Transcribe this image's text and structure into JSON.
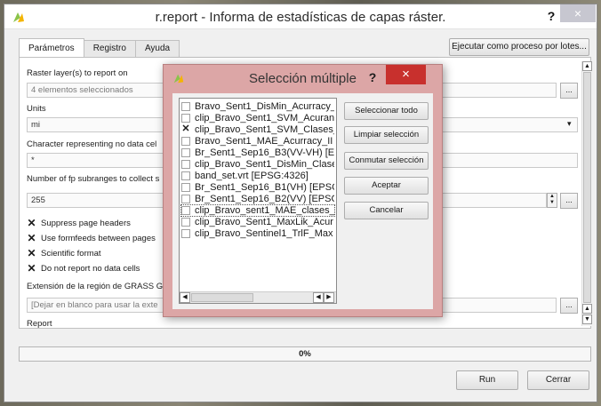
{
  "window": {
    "title": "r.report - Informa de estadísticas de capas ráster.",
    "help": "?",
    "close": "×"
  },
  "tabs": [
    {
      "label": "Parámetros",
      "active": true
    },
    {
      "label": "Registro",
      "active": false
    },
    {
      "label": "Ayuda",
      "active": false
    }
  ],
  "batch_button": "Ejecutar como proceso por lotes...",
  "form": {
    "raster_label": "Raster layer(s) to report on",
    "raster_value": "4 elementos seleccionados",
    "units_label": "Units",
    "units_value": "mi",
    "nodata_label": "Character representing no data cel",
    "nodata_value": "*",
    "fp_label": "Number of fp subranges to collect s",
    "fp_value": "255",
    "checks": [
      {
        "label": "Suppress page headers",
        "checked": true
      },
      {
        "label": "Use formfeeds between pages",
        "checked": true
      },
      {
        "label": "Scientific format",
        "checked": true
      },
      {
        "label": "Do not report no data cells",
        "checked": true
      }
    ],
    "region_label": "Extensión de la región de GRASS G",
    "region_placeholder": "[Dejar en blanco para usar la exte",
    "report_label": "Report",
    "browse": "...",
    "spin_up": "▲",
    "spin_down": "▼",
    "dropdown": "▾"
  },
  "progress": {
    "text": "0%",
    "value": 0
  },
  "buttons": {
    "run": "Run",
    "close": "Cerrar"
  },
  "modal": {
    "title": "Selección múltiple",
    "help": "?",
    "close": "×",
    "items": [
      {
        "label": "Bravo_Sent1_DisMin_Acurracy_",
        "checked": false
      },
      {
        "label": "clip_Bravo_Sent1_SVM_Acuran",
        "checked": false
      },
      {
        "label": "clip_Bravo_Sent1_SVM_Clases_",
        "checked": true
      },
      {
        "label": "Bravo_Sent1_MAE_Acurracy_II",
        "checked": false
      },
      {
        "label": "Br_Sent1_Sep16_B3(VV-VH) [E",
        "checked": false
      },
      {
        "label": "clip_Bravo_Sent1_DisMin_Clase",
        "checked": false
      },
      {
        "label": "band_set.vrt [EPSG:4326]",
        "checked": false
      },
      {
        "label": "Br_Sent1_Sep16_B1(VH) [EPSC",
        "checked": false
      },
      {
        "label": "Br_Sent1_Sep16_B2(VV) [EPSG",
        "checked": false
      },
      {
        "label": "clip_Bravo_sent1_MAE_clases_I",
        "checked": false
      },
      {
        "label": "clip_Bravo_Sent1_MaxLik_Acur",
        "checked": false
      },
      {
        "label": "clip_Bravo_Sentinel1_TrlF_Max",
        "checked": false
      }
    ],
    "select_all": "Seleccionar todo",
    "clear": "Limpiar selección",
    "toggle": "Conmutar selección",
    "accept": "Aceptar",
    "cancel": "Cancelar",
    "scroll_left": "◀",
    "scroll_right": "▶"
  },
  "colors": {
    "modal_bg": "#dca6a6",
    "modal_close": "#c8302d",
    "window_bg": "#f0f0f0"
  }
}
